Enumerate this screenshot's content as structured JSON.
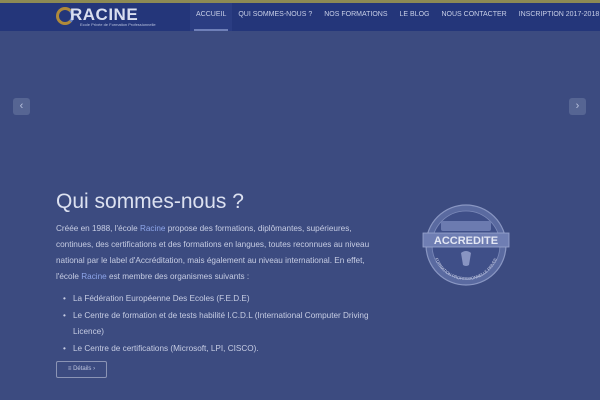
{
  "logo": {
    "name": "RACINE",
    "tagline": "Ecole Privée de Formation Professionnelle"
  },
  "nav": {
    "items": [
      {
        "label": "ACCUEIL",
        "active": true
      },
      {
        "label": "QUI SOMMES-NOUS ?"
      },
      {
        "label": "NOS FORMATIONS"
      },
      {
        "label": "LE BLOG"
      },
      {
        "label": "NOUS CONTACTER"
      },
      {
        "label": "INSCRIPTION 2017-2018"
      }
    ]
  },
  "slider": {
    "prev_glyph": "‹",
    "next_glyph": "›"
  },
  "content": {
    "title": "Qui sommes-nous ?",
    "para_part1": "Créée en 1988, l'école ",
    "brand": "Racine",
    "para_part2": " propose des formations, diplômantes, supérieures, continues, des certifications et des formations en langues, toutes reconnues au niveau national par le label d'Accréditation, mais également au niveau international. En effet, l'école ",
    "para_part3": " est membre des organismes suivants :",
    "list": [
      "La Fédération Européenne Des Ecoles (F.E.D.E)",
      "Le Centre de formation et de tests habilité I.C.D.L (International Computer Driving Licence)",
      "Le Centre de certifications (Microsoft, LPI, CISCO)."
    ],
    "details_label": "Détails"
  },
  "seal": {
    "word": "ACCREDITE",
    "arc": "FORMATION PROFESSIONNELLE PRIVEE"
  },
  "colors": {
    "background": "#3c4b80",
    "navbar": "#24367a",
    "accent": "#8ea6ea"
  }
}
